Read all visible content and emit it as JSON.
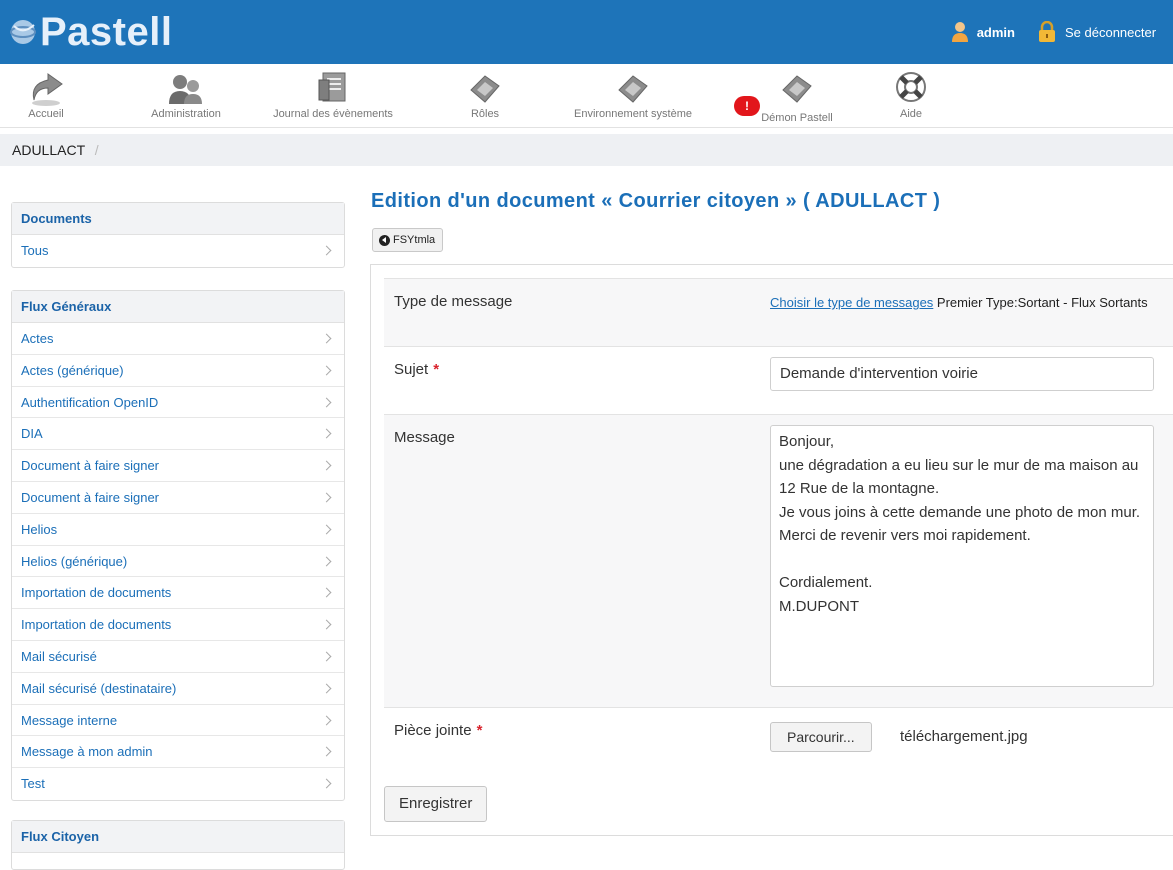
{
  "header": {
    "app_name": "Pastell",
    "user_name": "admin",
    "logout_label": "Se déconnecter",
    "icons": {
      "user": "user-icon",
      "logout": "padlock-icon"
    },
    "colors": {
      "bar": "#1e74b9"
    }
  },
  "toolbar": {
    "items": [
      {
        "label": "Accueil",
        "icon": "home-arrow-icon"
      },
      {
        "label": "Administration",
        "icon": "users-icon"
      },
      {
        "label": "Journal des évènements",
        "icon": "journal-icon"
      },
      {
        "label": "Rôles",
        "icon": "roles-icon"
      },
      {
        "label": "Environnement système",
        "icon": "system-icon"
      },
      {
        "label": "Démon Pastell",
        "icon": "daemon-icon"
      },
      {
        "label": "Aide",
        "icon": "lifebuoy-icon"
      }
    ],
    "notification_badge": "!"
  },
  "breadcrumb": {
    "entity": "ADULLACT",
    "separator": "/"
  },
  "sidebar": {
    "documents": {
      "title": "Documents",
      "items": [
        "Tous"
      ]
    },
    "flux_generaux": {
      "title": "Flux Généraux",
      "items": [
        "Actes",
        "Actes (générique)",
        "Authentification OpenID",
        "DIA",
        "Document à faire signer",
        "Document à faire signer",
        "Helios",
        "Helios (générique)",
        "Importation de documents",
        "Importation de documents",
        "Mail sécurisé",
        "Mail sécurisé (destinataire)",
        "Message interne",
        "Message à mon admin",
        "Test"
      ]
    },
    "flux_citoyen": {
      "title": "Flux Citoyen"
    }
  },
  "main": {
    "title": "Edition d'un document « Courrier citoyen » ( ADULLACT )",
    "back_button": "FSYtmla",
    "form": {
      "type_label": "Type de message",
      "type_link": "Choisir le type de messages",
      "type_value": " Premier Type:Sortant - Flux Sortants",
      "subject_label": "Sujet",
      "subject_value": "Demande d'intervention voirie",
      "message_label": "Message",
      "message_value": "Bonjour,\nune dégradation a eu lieu sur le mur de ma maison au 12 Rue de la montagne.\nJe vous joins à cette demande une photo de mon mur.\nMerci de revenir vers moi rapidement.\n\nCordialement.\nM.DUPONT",
      "attachment_label": "Pièce jointe",
      "browse_button": "Parcourir...",
      "file_name": "téléchargement.jpg",
      "required_mark": "*"
    },
    "save_button": "Enregistrer"
  }
}
